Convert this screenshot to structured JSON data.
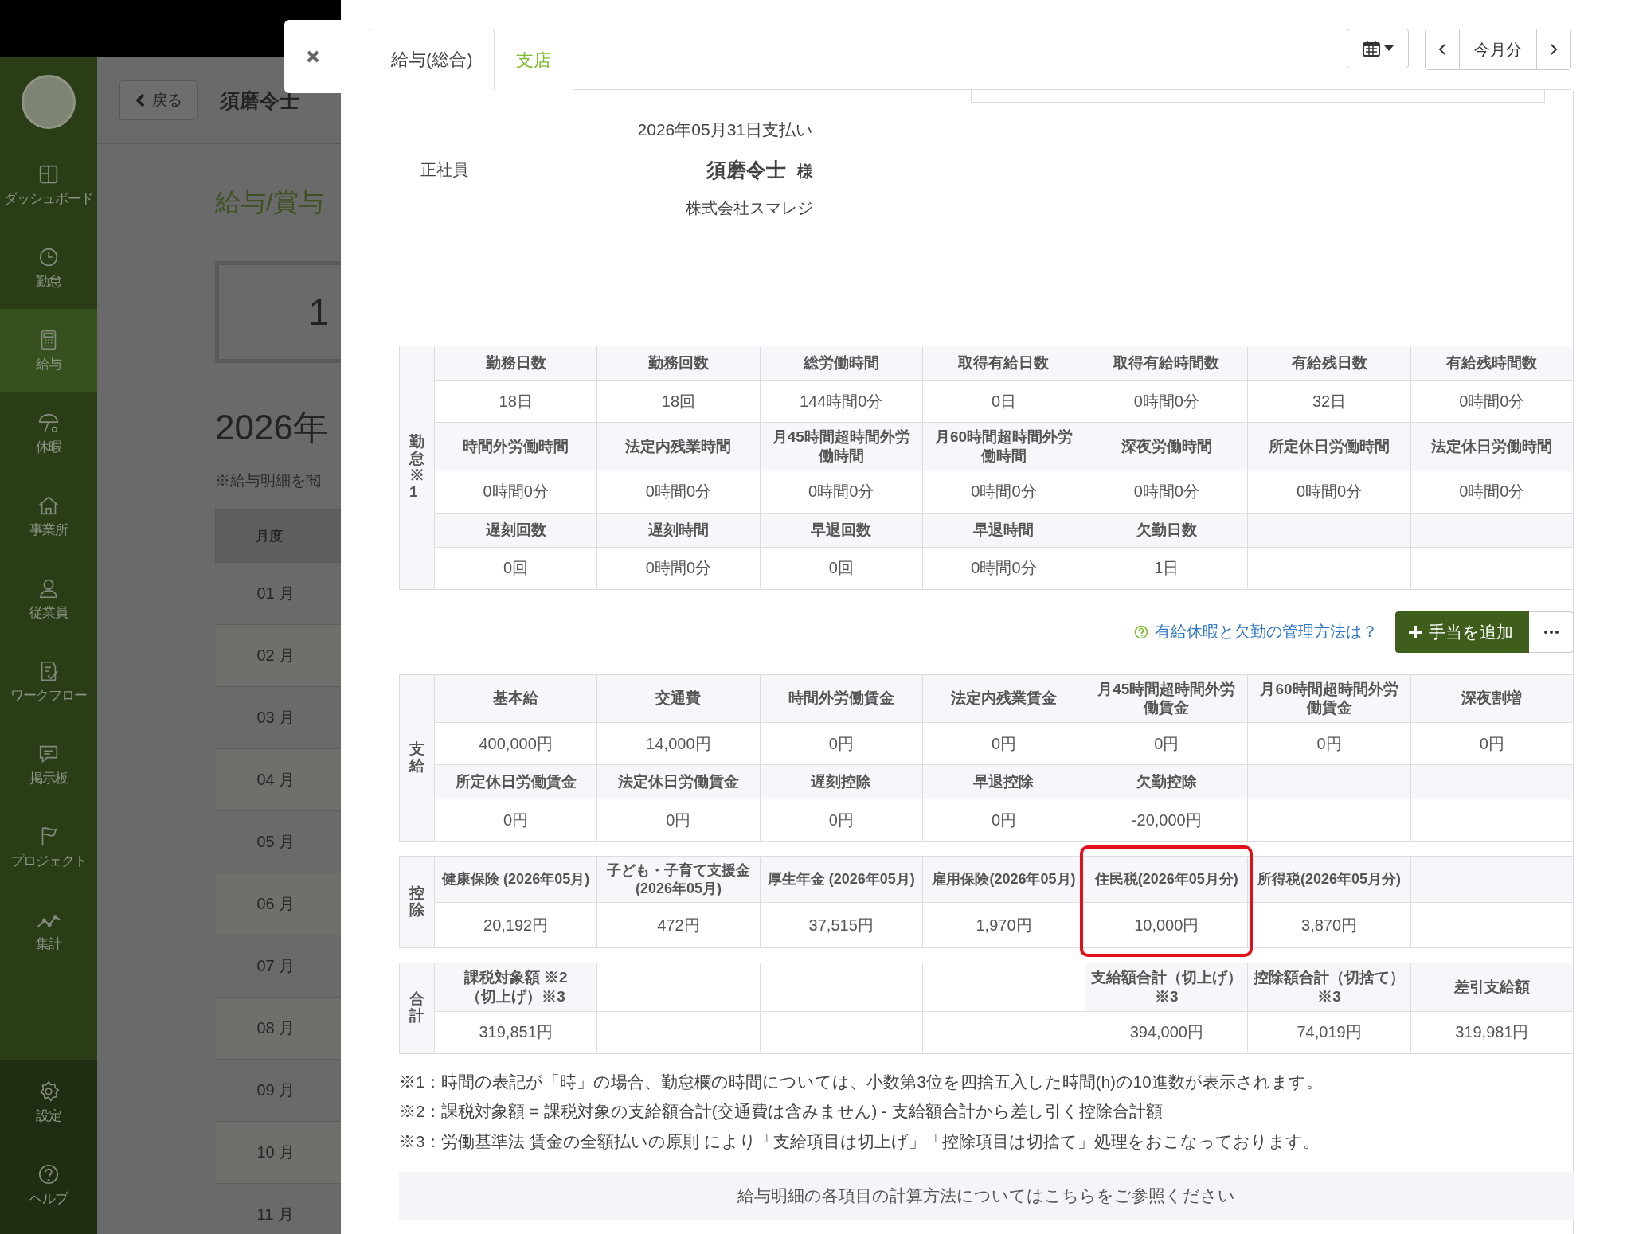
{
  "background_page": {
    "back_button": "戻る",
    "employee_name": "須磨令士",
    "title": "給与/賞与",
    "summary_value": "1",
    "year_heading": "2026年",
    "note": "※給与明細を閲",
    "sidebar": {
      "items": [
        {
          "label": "ダッシュボード",
          "selected": false
        },
        {
          "label": "勤怠",
          "selected": false
        },
        {
          "label": "給与",
          "selected": true
        },
        {
          "label": "休暇",
          "selected": false
        },
        {
          "label": "事業所",
          "selected": false
        },
        {
          "label": "従業員",
          "selected": false
        },
        {
          "label": "ワークフロー",
          "selected": false
        },
        {
          "label": "掲示板",
          "selected": false
        },
        {
          "label": "プロジェクト",
          "selected": false
        },
        {
          "label": "集計",
          "selected": false
        }
      ],
      "footer_items": [
        {
          "label": "設定"
        },
        {
          "label": "ヘルプ"
        }
      ]
    },
    "months_table": {
      "header": "月度",
      "rows": [
        "01 月",
        "02 月",
        "03 月",
        "04 月",
        "05 月",
        "06 月",
        "07 月",
        "08 月",
        "09 月",
        "10 月",
        "11 月"
      ]
    }
  },
  "tabs": [
    {
      "label": "給与(総合)",
      "selected": true
    },
    {
      "label": "支店",
      "selected": false
    }
  ],
  "period_nav": {
    "label": "今月分"
  },
  "payslip": {
    "pay_date": "2026年05月31日支払い",
    "employment_type": "正社員",
    "employee_name": "須磨令士",
    "honorific": "様",
    "company": "株式会社スマレジ"
  },
  "attendance": {
    "label": "勤怠※1",
    "groups": [
      {
        "items": [
          {
            "label": "勤務日数",
            "value": "18日"
          },
          {
            "label": "勤務回数",
            "value": "18回"
          },
          {
            "label": "総労働時間",
            "value": "144時間0分"
          },
          {
            "label": "取得有給日数",
            "value": "0日"
          },
          {
            "label": "取得有給時間数",
            "value": "0時間0分"
          },
          {
            "label": "有給残日数",
            "value": "32日"
          },
          {
            "label": "有給残時間数",
            "value": "0時間0分"
          }
        ]
      },
      {
        "items": [
          {
            "label": "時間外労働時間",
            "value": "0時間0分"
          },
          {
            "label": "法定内残業時間",
            "value": "0時間0分"
          },
          {
            "label": "月45時間超時間外労働時間",
            "value": "0時間0分"
          },
          {
            "label": "月60時間超時間外労働時間",
            "value": "0時間0分"
          },
          {
            "label": "深夜労働時間",
            "value": "0時間0分"
          },
          {
            "label": "所定休日労働時間",
            "value": "0時間0分"
          },
          {
            "label": "法定休日労働時間",
            "value": "0時間0分"
          }
        ]
      },
      {
        "items": [
          {
            "label": "遅刻回数",
            "value": "0回"
          },
          {
            "label": "遅刻時間",
            "value": "0時間0分"
          },
          {
            "label": "早退回数",
            "value": "0回"
          },
          {
            "label": "早退時間",
            "value": "0時間0分"
          },
          {
            "label": "欠勤日数",
            "value": "1日"
          }
        ]
      }
    ]
  },
  "help_link": "有給休暇と欠勤の管理方法は？",
  "add_button": "手当を追加",
  "pay_sections": [
    {
      "label": "支給",
      "groups": [
        {
          "items": [
            {
              "label": "基本給",
              "value": "400,000円"
            },
            {
              "label": "交通費",
              "value": "14,000円"
            },
            {
              "label": "時間外労働賃金",
              "value": "0円"
            },
            {
              "label": "法定内残業賃金",
              "value": "0円"
            },
            {
              "label": "月45時間超時間外労働賃金",
              "value": "0円"
            },
            {
              "label": "月60時間超時間外労働賃金",
              "value": "0円"
            },
            {
              "label": "深夜割増",
              "value": "0円"
            }
          ]
        },
        {
          "items": [
            {
              "label": "所定休日労働賃金",
              "value": "0円"
            },
            {
              "label": "法定休日労働賃金",
              "value": "0円"
            },
            {
              "label": "遅刻控除",
              "value": "0円"
            },
            {
              "label": "早退控除",
              "value": "0円"
            },
            {
              "label": "欠勤控除",
              "value": "-20,000円"
            }
          ]
        }
      ]
    },
    {
      "label": "控除",
      "groups": [
        {
          "items": [
            {
              "label": "健康保険 (2026年05月)",
              "value": "20,192円",
              "highlighted": false
            },
            {
              "label": "子ども・子育て支援金(2026年05月)",
              "value": "472円",
              "highlighted": false
            },
            {
              "label": "厚生年金 (2026年05月)",
              "value": "37,515円",
              "highlighted": false
            },
            {
              "label": "雇用保険(2026年05月)",
              "value": "1,970円",
              "highlighted": false
            },
            {
              "label": "住民税(2026年05月分)",
              "value": "10,000円",
              "highlighted": true
            },
            {
              "label": "所得税(2026年05月分)",
              "value": "3,870円",
              "highlighted": false
            }
          ]
        }
      ]
    },
    {
      "label": "合計",
      "groups": [
        {
          "items": [
            {
              "kind": "field",
              "label": "課税対象額 ※2（切上げ）※3",
              "value": "319,851円"
            },
            {
              "kind": "blank"
            },
            {
              "kind": "blank"
            },
            {
              "kind": "blank"
            },
            {
              "kind": "field",
              "label": "支給額合計（切上げ）※3",
              "value": "394,000円"
            },
            {
              "kind": "field",
              "label": "控除額合計（切捨て）※3",
              "value": "74,019円"
            },
            {
              "kind": "field",
              "label": "差引支給額",
              "value": "319,981円"
            }
          ]
        }
      ]
    }
  ],
  "notes": [
    "※1：時間の表記が「時」の場合、勤怠欄の時間については、小数第3位を四捨五入した時間(h)の10進数が表示されます。",
    "※2：課税対象額 = 課税対象の支給額合計(交通費は含みません) - 支給額合計から差し引く控除合計額",
    "※3：労働基準法 賃金の全額払いの原則 により「支給項目は切上げ」「控除項目は切捨て」処理をおこなっております。"
  ],
  "footer_link": "給与明細の各項目の計算方法についてはこちらをご参照ください"
}
